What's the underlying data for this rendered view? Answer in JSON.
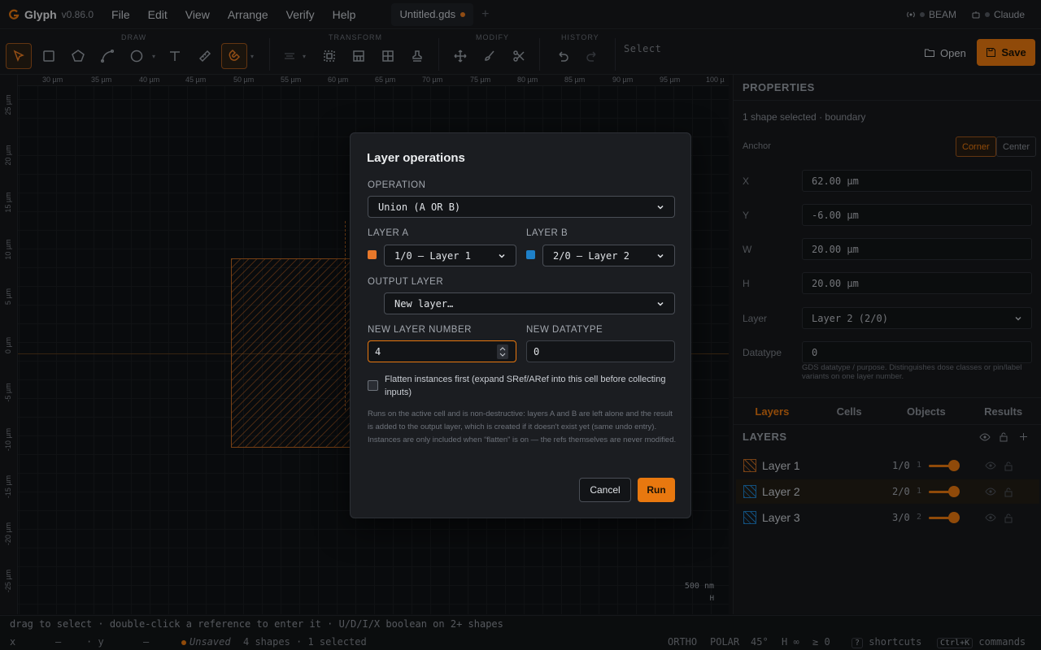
{
  "app": {
    "name": "Glyph",
    "version": "v0.86.0"
  },
  "menu": [
    "File",
    "Edit",
    "View",
    "Arrange",
    "Verify",
    "Help"
  ],
  "document_tab": {
    "title": "Untitled.gds",
    "new_tab": "+"
  },
  "top_right": {
    "beam": "BEAM",
    "assistant": "Claude"
  },
  "toolbar": {
    "groups": {
      "draw": "DRAW",
      "transform": "TRANSFORM",
      "modify": "MODIFY",
      "history": "HISTORY"
    },
    "mode_hint": "Select",
    "open_label": "Open",
    "save_label": "Save"
  },
  "canvas": {
    "ruler_top": [
      "30 µm",
      "35 µm",
      "40 µm",
      "45 µm",
      "50 µm",
      "55 µm",
      "60 µm",
      "65 µm",
      "70 µm",
      "75 µm",
      "80 µm",
      "85 µm",
      "90 µm",
      "95 µm",
      "100 µ"
    ],
    "ruler_left": [
      "25 µm",
      "20 µm",
      "15 µm",
      "10 µm",
      "5 µm",
      "0 µm",
      "-5 µm",
      "-10 µm",
      "-15 µm",
      "-20 µm",
      "-25 µm"
    ],
    "scale_label": "500 nm",
    "scale_axis": "H"
  },
  "properties": {
    "title": "PROPERTIES",
    "selection": "1 shape selected · boundary",
    "anchor_label": "Anchor",
    "anchor_corner": "Corner",
    "anchor_center": "Center",
    "x_label": "X",
    "x_value": "62.00 µm",
    "y_label": "Y",
    "y_value": "-6.00 µm",
    "w_label": "W",
    "w_value": "20.00 µm",
    "h_label": "H",
    "h_value": "20.00 µm",
    "layer_label": "Layer",
    "layer_value": "Layer 2 (2/0)",
    "datatype_label": "Datatype",
    "datatype_value": "0",
    "datatype_help": "GDS datatype / purpose. Distinguishes dose classes or pin/label variants on one layer number."
  },
  "panel_tabs": [
    "Layers",
    "Cells",
    "Objects",
    "Results"
  ],
  "layers": {
    "title": "LAYERS",
    "items": [
      {
        "name": "Layer 1",
        "num": "1/0",
        "count": "1",
        "color": "#c26a22"
      },
      {
        "name": "Layer 2",
        "num": "2/0",
        "count": "1",
        "color": "#1e80c8"
      },
      {
        "name": "Layer 3",
        "num": "3/0",
        "count": "2",
        "color": "#1e80c8"
      }
    ]
  },
  "status": {
    "hint": "drag to select · double-click a reference to enter it · U/D/I/X boolean on 2+ shapes",
    "x": "x",
    "x_val": "—",
    "y": "· y",
    "y_val": "—",
    "unsaved": "Unsaved",
    "counts": "4 shapes · 1 selected",
    "ortho": "ORTHO",
    "polar": "POLAR",
    "angle": "45°",
    "h": "H ∞",
    "ge": "≥ 0",
    "shortcuts_key": "?",
    "shortcuts": "shortcuts",
    "commands_key": "Ctrl+K",
    "commands": "commands"
  },
  "dialog": {
    "title": "Layer operations",
    "operation_label": "OPERATION",
    "operation_value": "Union (A OR B)",
    "layer_a_label": "LAYER A",
    "layer_a_value": "1/0 — Layer 1",
    "layer_b_label": "LAYER B",
    "layer_b_value": "2/0 — Layer 2",
    "output_label": "OUTPUT LAYER",
    "output_value": "New layer…",
    "new_number_label": "NEW LAYER NUMBER",
    "new_number_value": "4",
    "new_datatype_label": "NEW DATATYPE",
    "new_datatype_value": "0",
    "flatten_label": "Flatten instances first (expand SRef/ARef into this cell before collecting inputs)",
    "description": "Runs on the active cell and is non-destructive: layers A and B are left alone and the result is added to the output layer, which is created if it doesn't exist yet (same undo entry). Instances are only included when “flatten” is on — the refs themselves are never modified.",
    "cancel_label": "Cancel",
    "run_label": "Run",
    "colors": {
      "layer_a": "#e8782a",
      "layer_b": "#1e80c8",
      "accent": "#e8780f"
    }
  }
}
